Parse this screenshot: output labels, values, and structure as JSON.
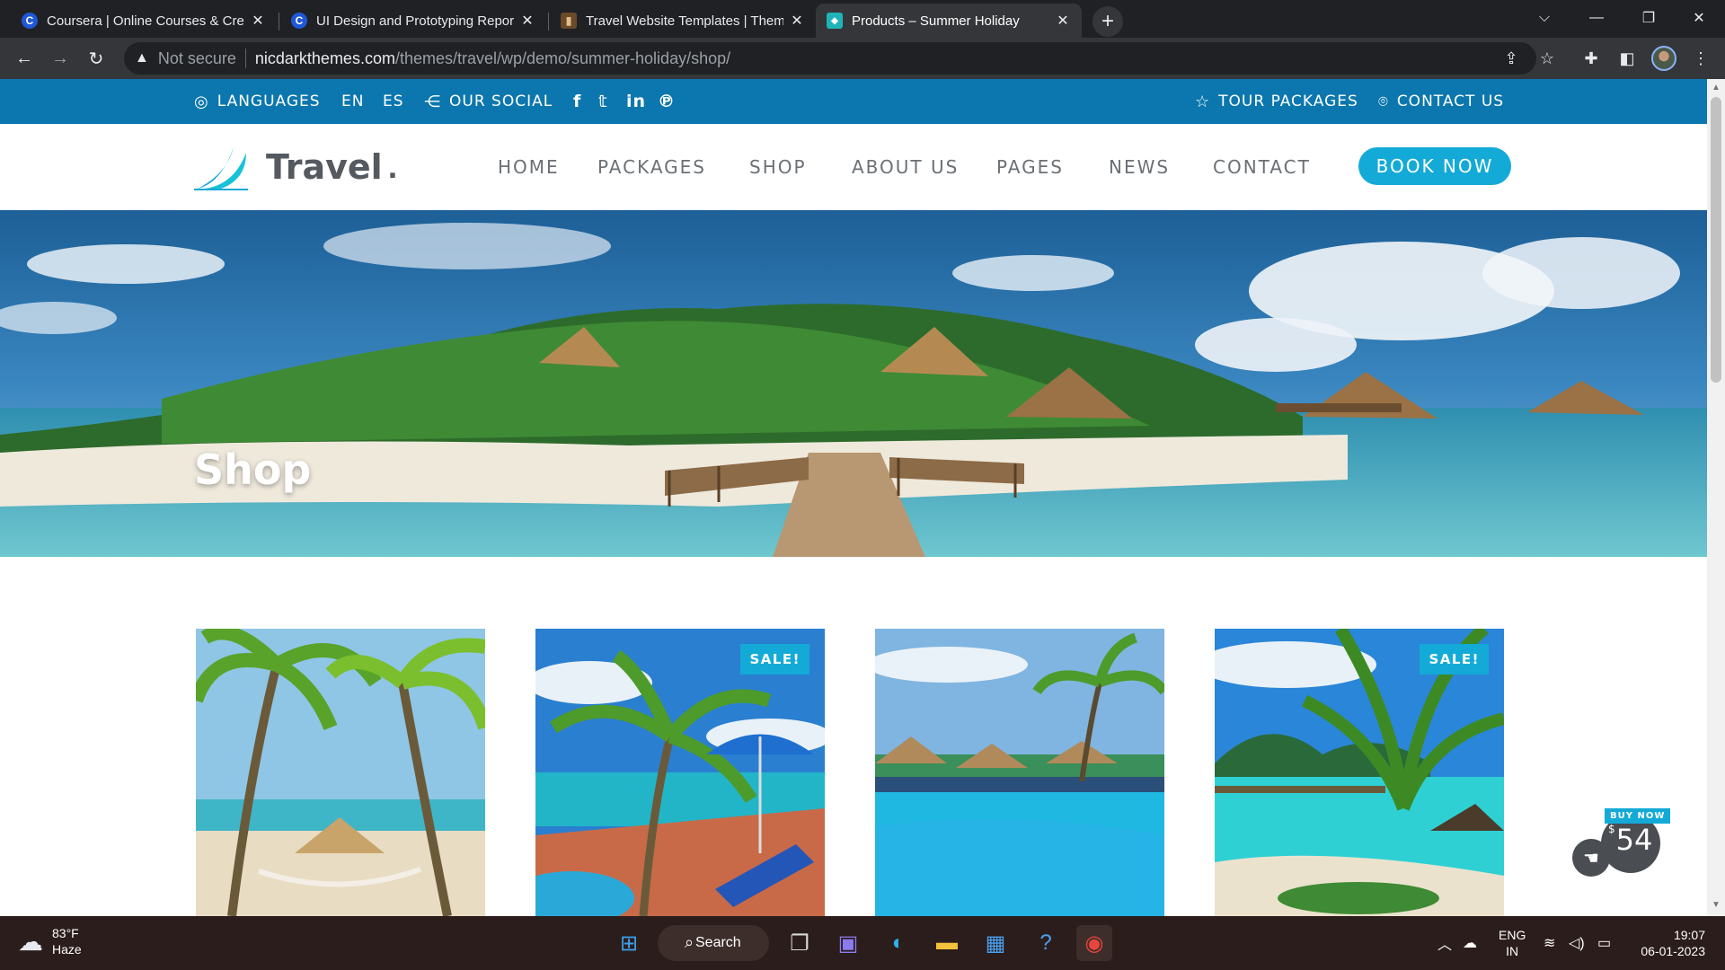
{
  "browser": {
    "tabs": [
      {
        "title": "Coursera | Online Courses & Credentials",
        "icon": "coursera-icon",
        "active": false
      },
      {
        "title": "UI Design and Prototyping Report",
        "icon": "coursera-icon",
        "active": false
      },
      {
        "title": "Travel Website Templates | Themes",
        "icon": "themeforest-icon",
        "active": false
      },
      {
        "title": "Products – Summer Holiday",
        "icon": "site-favicon",
        "active": true
      }
    ],
    "address": {
      "security": "Not secure",
      "domain": "nicdarkthemes.com",
      "path": "/themes/travel/wp/demo/summer-holiday/shop/"
    }
  },
  "site": {
    "topbar": {
      "languages": "LANGUAGES",
      "lang_en": "EN",
      "lang_es": "ES",
      "social": "OUR SOCIAL",
      "social_icons": [
        "facebook-icon",
        "twitter-icon",
        "linkedin-icon",
        "pinterest-icon"
      ],
      "tour_packages": "TOUR PACKAGES",
      "contact_us": "CONTACT US"
    },
    "logo": {
      "text": "Travel",
      "dot": "."
    },
    "menu": [
      "HOME",
      "PACKAGES",
      "SHOP",
      "ABOUT US",
      "PAGES",
      "NEWS",
      "CONTACT"
    ],
    "book_now": "BOOK NOW",
    "hero_title": "Shop",
    "products": [
      {
        "sale": "",
        "scene": "hammock-beach"
      },
      {
        "sale": "SALE!",
        "scene": "umbrella-terrace"
      },
      {
        "sale": "",
        "scene": "resort-pool"
      },
      {
        "sale": "SALE!",
        "scene": "lagoon-bungalows"
      }
    ],
    "buy_widget": {
      "label": "BUY NOW",
      "currency": "$",
      "price": "54"
    }
  },
  "taskbar": {
    "temperature": "83°F",
    "condition": "Haze",
    "search": "Search",
    "lang_line1": "ENG",
    "lang_line2": "IN",
    "time": "19:07",
    "date": "06-01-2023"
  },
  "colors": {
    "topbar_blue": "#0c77ae",
    "accent_cyan": "#14aad7",
    "menu_gray": "#6b7075",
    "taskbar_bg": "#2b1d1b"
  }
}
